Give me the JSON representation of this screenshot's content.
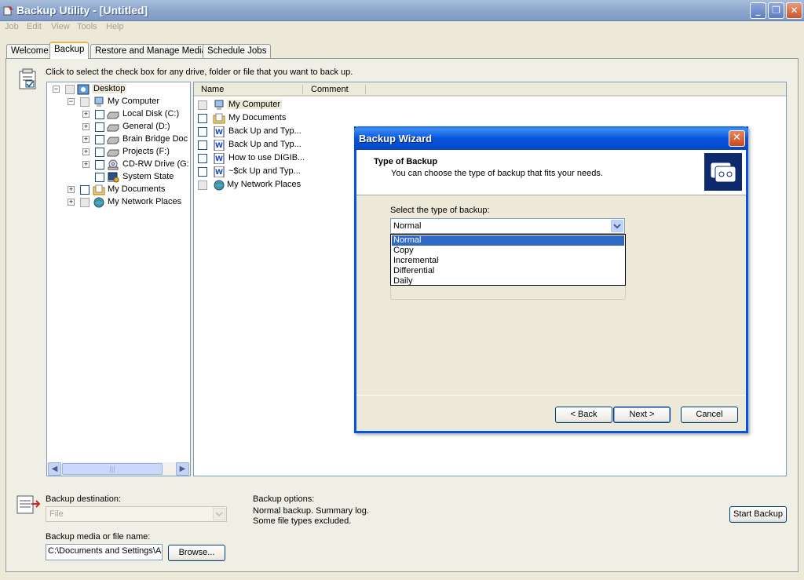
{
  "window": {
    "title": "Backup Utility - [Untitled]"
  },
  "menu": [
    "Job",
    "Edit",
    "View",
    "Tools",
    "Help"
  ],
  "tabs": [
    "Welcome",
    "Backup",
    "Restore and Manage Media",
    "Schedule Jobs"
  ],
  "instruction": "Click to select the check box for any drive, folder or file that you want to back up.",
  "tree": {
    "desktop": "Desktop",
    "my_computer": "My Computer",
    "local_disk": "Local Disk (C:)",
    "general": "General (D:)",
    "brain_bridge": "Brain Bridge Doc",
    "projects": "Projects (F:)",
    "cdrw": "CD-RW Drive (G:",
    "system_state": "System State",
    "my_documents": "My Documents",
    "my_network": "My Network Places"
  },
  "list": {
    "columns": [
      "Name",
      "Comment"
    ],
    "items": [
      "My Computer",
      "My Documents",
      "Back Up and Typ...",
      "Back Up and Typ...",
      "How to use DIGIB...",
      "~$ck Up and Typ...",
      "My Network Places"
    ]
  },
  "wizard": {
    "title": "Backup Wizard",
    "heading": "Type of Backup",
    "subheading": "You can choose the type of backup that fits your needs.",
    "select_label": "Select the type of backup:",
    "selected": "Normal",
    "options": [
      "Normal",
      "Copy",
      "Incremental",
      "Differential",
      "Daily"
    ],
    "back": "< Back",
    "next": "Next >",
    "cancel": "Cancel"
  },
  "bottom": {
    "destination_label": "Backup destination:",
    "destination_value": "File",
    "media_label": "Backup media or file name:",
    "media_value": "C:\\Documents and Settings\\A",
    "browse": "Browse...",
    "options_label": "Backup options:",
    "options_line1": "Normal backup.  Summary log.",
    "options_line2": "Some file types excluded.",
    "start": "Start Backup"
  }
}
